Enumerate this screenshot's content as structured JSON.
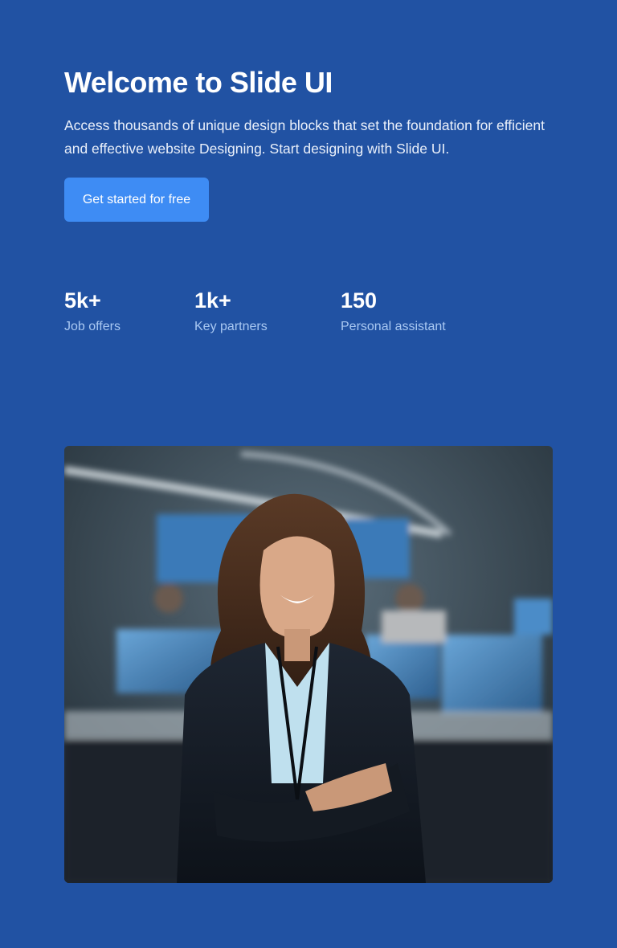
{
  "hero": {
    "title": "Welcome to Slide UI",
    "description": "Access thousands of unique design blocks that set the foundation for efficient and effective website Designing. Start designing with Slide UI.",
    "cta_label": "Get started for free"
  },
  "stats": [
    {
      "value": "5k+",
      "label": "Job offers"
    },
    {
      "value": "1k+",
      "label": "Key partners"
    },
    {
      "value": "150",
      "label": "Personal assistant"
    }
  ],
  "colors": {
    "background": "#2152a3",
    "cta": "#3e8cf4",
    "stat_label": "#a9c8f2"
  }
}
